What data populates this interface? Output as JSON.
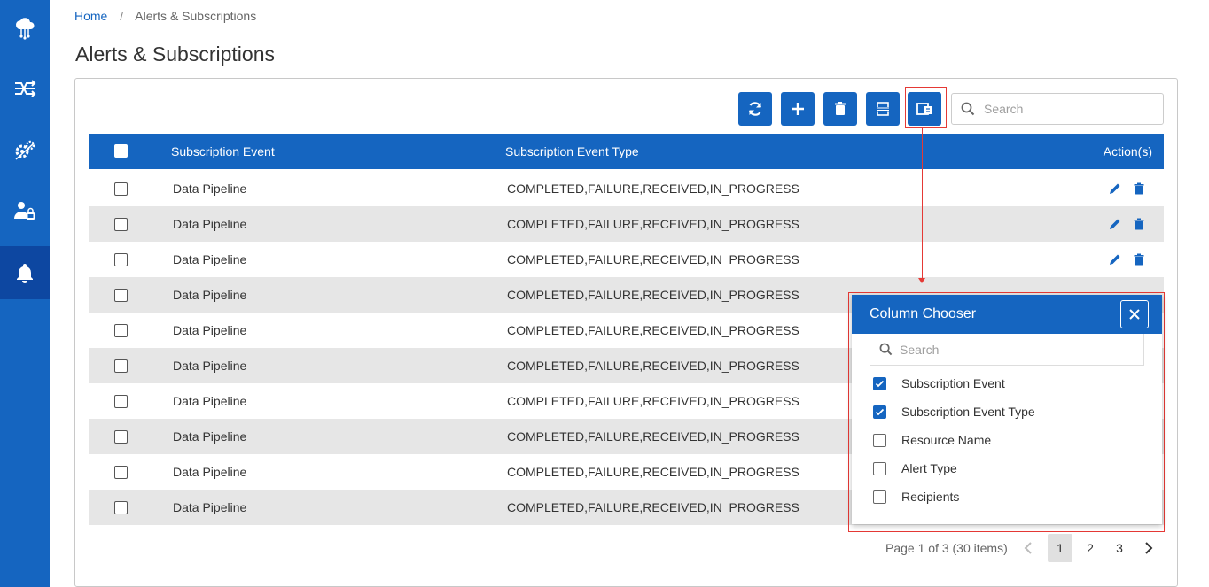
{
  "sidebar": {
    "items": [
      {
        "icon": "cloud-network-icon"
      },
      {
        "icon": "pipelines-icon"
      },
      {
        "icon": "gears-icon"
      },
      {
        "icon": "user-lock-icon"
      },
      {
        "icon": "bell-icon",
        "active": true
      }
    ]
  },
  "breadcrumb": {
    "home": "Home",
    "separator": "/",
    "current": "Alerts & Subscriptions"
  },
  "page_title": "Alerts & Subscriptions",
  "toolbar": {
    "buttons": [
      "refresh-icon",
      "add-icon",
      "delete-icon",
      "export-xlsx-icon",
      "column-chooser-icon"
    ],
    "search_placeholder": "Search"
  },
  "grid": {
    "columns": [
      "Subscription Event",
      "Subscription Event Type",
      "Action(s)"
    ],
    "rows": [
      {
        "event": "Data Pipeline",
        "type": "COMPLETED,FAILURE,RECEIVED,IN_PROGRESS"
      },
      {
        "event": "Data Pipeline",
        "type": "COMPLETED,FAILURE,RECEIVED,IN_PROGRESS"
      },
      {
        "event": "Data Pipeline",
        "type": "COMPLETED,FAILURE,RECEIVED,IN_PROGRESS"
      },
      {
        "event": "Data Pipeline",
        "type": "COMPLETED,FAILURE,RECEIVED,IN_PROGRESS"
      },
      {
        "event": "Data Pipeline",
        "type": "COMPLETED,FAILURE,RECEIVED,IN_PROGRESS"
      },
      {
        "event": "Data Pipeline",
        "type": "COMPLETED,FAILURE,RECEIVED,IN_PROGRESS"
      },
      {
        "event": "Data Pipeline",
        "type": "COMPLETED,FAILURE,RECEIVED,IN_PROGRESS"
      },
      {
        "event": "Data Pipeline",
        "type": "COMPLETED,FAILURE,RECEIVED,IN_PROGRESS"
      },
      {
        "event": "Data Pipeline",
        "type": "COMPLETED,FAILURE,RECEIVED,IN_PROGRESS"
      },
      {
        "event": "Data Pipeline",
        "type": "COMPLETED,FAILURE,RECEIVED,IN_PROGRESS"
      }
    ]
  },
  "column_chooser": {
    "title": "Column Chooser",
    "search_placeholder": "Search",
    "items": [
      {
        "label": "Subscription Event",
        "checked": true
      },
      {
        "label": "Subscription Event Type",
        "checked": true
      },
      {
        "label": "Resource Name",
        "checked": false
      },
      {
        "label": "Alert Type",
        "checked": false
      },
      {
        "label": "Recipients",
        "checked": false
      }
    ]
  },
  "pager": {
    "info": "Page 1 of 3 (30 items)",
    "pages": [
      "1",
      "2",
      "3"
    ],
    "current_page": "1"
  },
  "colors": {
    "primary": "#1565c0",
    "primary_dark": "#0d47a1",
    "highlight": "#e53935",
    "alt_row": "#e6e6e6"
  }
}
